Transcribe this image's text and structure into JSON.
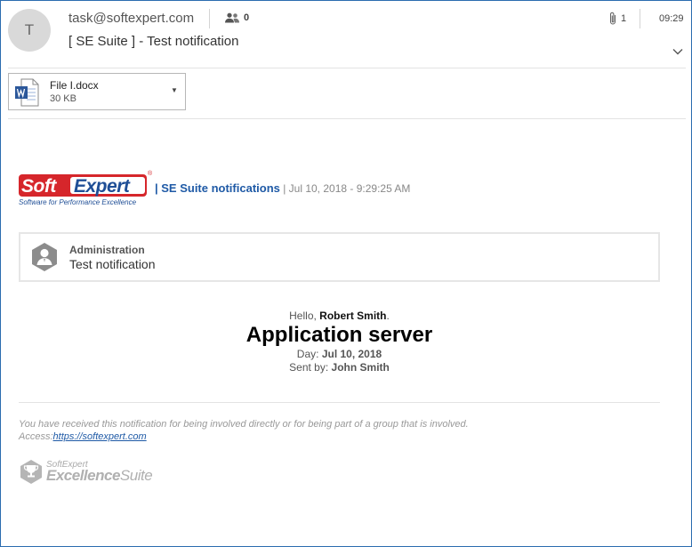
{
  "header": {
    "avatar_initial": "T",
    "sender": "task@softexpert.com",
    "recipients_count": "0",
    "subject": "[ SE Suite ] - Test notification",
    "attachment_count": "1",
    "time": "09:29"
  },
  "attachment": {
    "name": "File I.docx",
    "size": "30 KB",
    "icon": "word-document-icon"
  },
  "email": {
    "logo": {
      "soft": "Soft",
      "expert": "Expert",
      "registered": "®",
      "tagline": "Software for Performance Excellence"
    },
    "notification_title": "| SE Suite notifications",
    "notification_date": " | Jul 10, 2018 - 9:29:25 AM",
    "card": {
      "category": "Administration",
      "title": "Test notification",
      "icon": "user-hexagon-icon"
    },
    "hello_label": "Hello, ",
    "recipient_name": "Robert Smith",
    "hello_suffix": ".",
    "main_title": "Application server",
    "day_label": "Day: ",
    "day_value": "Jul 10, 2018",
    "sent_label": "Sent by: ",
    "sent_value": "John Smith",
    "footer_text": "You have received this notification for being involved directly or for being part of a group that is involved.",
    "access_label": "Access:",
    "access_link": "https://softexpert.com",
    "excellence": {
      "small": "SoftExpert",
      "big_bold": "Excellence",
      "big_light": "Suite"
    }
  },
  "colors": {
    "brand_red": "#d6262b",
    "brand_blue": "#1f4e96",
    "link_blue": "#1f5aa6",
    "window_border": "#2b6cb0"
  }
}
